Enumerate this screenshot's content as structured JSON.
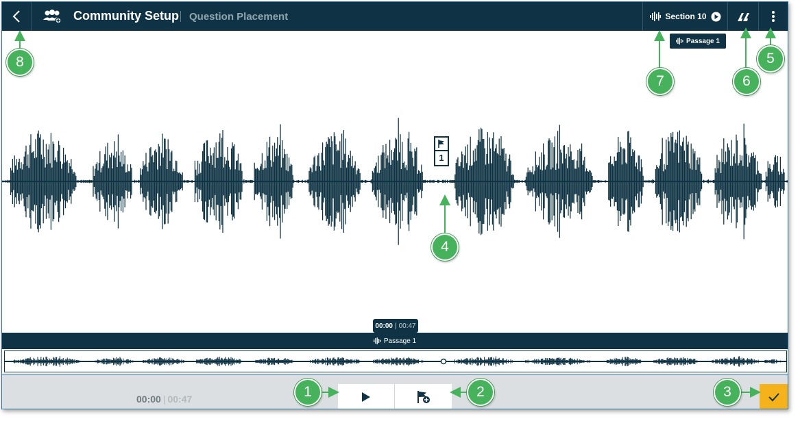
{
  "header": {
    "title": "Community Setup",
    "subtitle": "Question Placement",
    "section_label": "Section 10",
    "passage_tooltip": "Passage 1"
  },
  "icons": {
    "back": "chevron-left-icon",
    "community": "people-group-icon",
    "section_play": "play-circle-icon",
    "quote": "quote-icon",
    "more": "kebab-menu-icon",
    "flag": "flag-icon",
    "add_flag": "flag-add-icon",
    "play": "play-icon",
    "check": "check-icon",
    "audio": "audio-wave-icon"
  },
  "waveform": {
    "marker_number": "1",
    "time_tooltip": {
      "current": "00:00",
      "separator": "|",
      "total": "00:47"
    },
    "mini_label": "Passage 1"
  },
  "footer": {
    "time_current": "00:00",
    "time_separator": "|",
    "time_total": "00:47"
  },
  "annotations": [
    "1",
    "2",
    "3",
    "4",
    "5",
    "6",
    "7",
    "8"
  ],
  "colors": {
    "navy": "#0f3344",
    "accent_yellow": "#f6b21b",
    "annotation_green": "#47b25c",
    "footer_bg": "#dcdfe1"
  }
}
